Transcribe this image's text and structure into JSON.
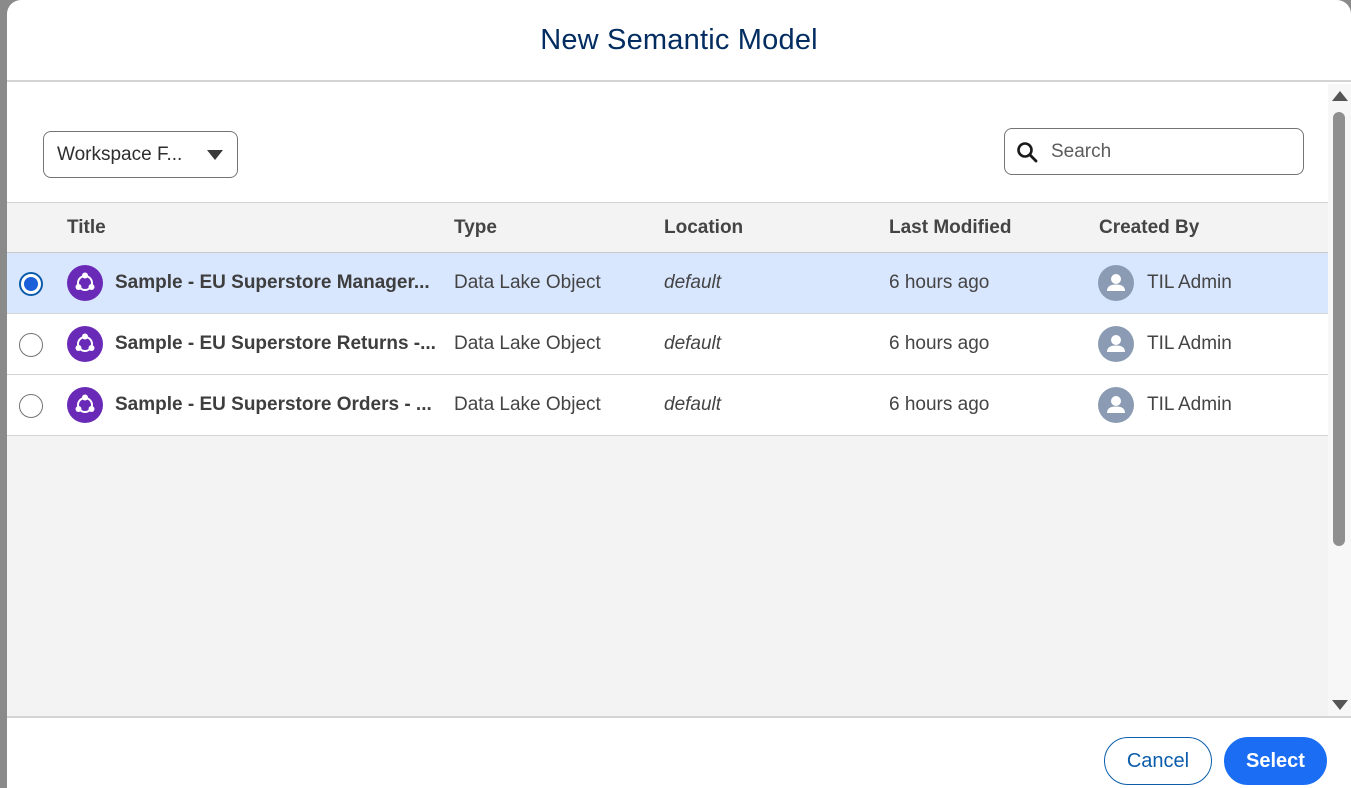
{
  "modal": {
    "title": "New Semantic Model"
  },
  "filter": {
    "selected": "Workspace F..."
  },
  "search": {
    "placeholder": "Search",
    "value": ""
  },
  "table": {
    "columns": [
      "Title",
      "Type",
      "Location",
      "Last Modified",
      "Created By"
    ],
    "rows": [
      {
        "title": "Sample - EU Superstore Manager...",
        "type": "Data Lake Object",
        "location": "default",
        "modified": "6 hours ago",
        "created_by": "TIL Admin",
        "selected": true
      },
      {
        "title": "Sample - EU Superstore Returns -...",
        "type": "Data Lake Object",
        "location": "default",
        "modified": "6 hours ago",
        "created_by": "TIL Admin",
        "selected": false
      },
      {
        "title": "Sample - EU Superstore Orders - ...",
        "type": "Data Lake Object",
        "location": "default",
        "modified": "6 hours ago",
        "created_by": "TIL Admin",
        "selected": false
      }
    ]
  },
  "footer": {
    "cancel_label": "Cancel",
    "select_label": "Select"
  },
  "colors": {
    "accent": "#1b6ef3",
    "selected_row": "#d8e6fe",
    "model_icon": "#6a2ab8",
    "avatar": "#8a9bb3"
  }
}
